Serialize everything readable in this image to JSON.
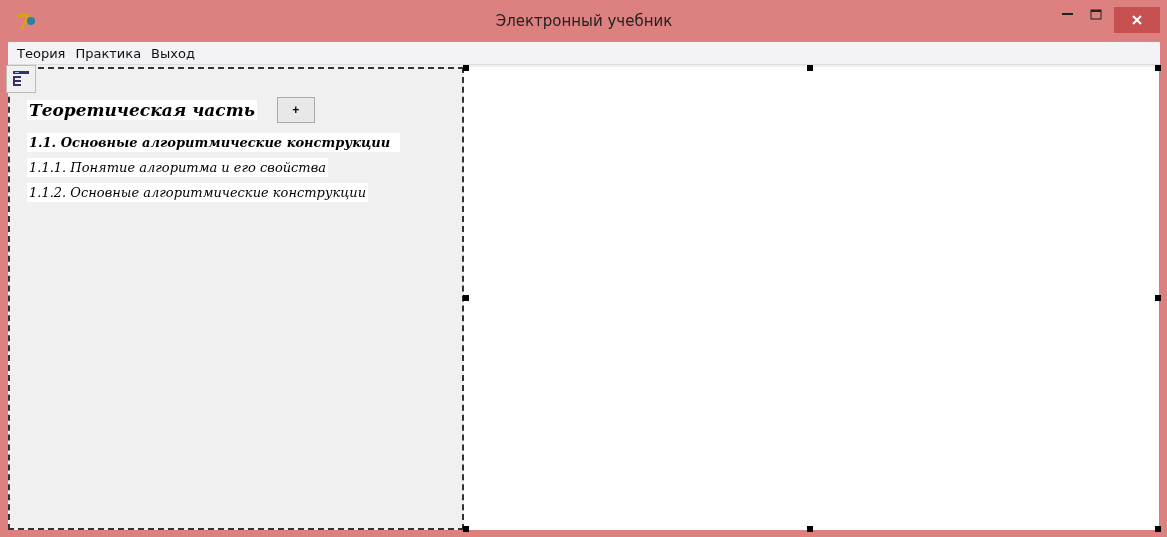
{
  "window": {
    "title": "Электронный учебник"
  },
  "menu": [
    "Теория",
    "Практика",
    "Выход"
  ],
  "sidebar": {
    "heading": "Теоретическая часть",
    "expand_button": "+",
    "topics": [
      {
        "kind": "section",
        "label": "1.1.  Основные алгоритмические конструкции"
      },
      {
        "kind": "subsection",
        "label": "1.1.1. Понятие алгоритма и его свойства"
      },
      {
        "kind": "subsection",
        "label": "1.1.2. Основные алгоритмические конструкции"
      }
    ]
  }
}
